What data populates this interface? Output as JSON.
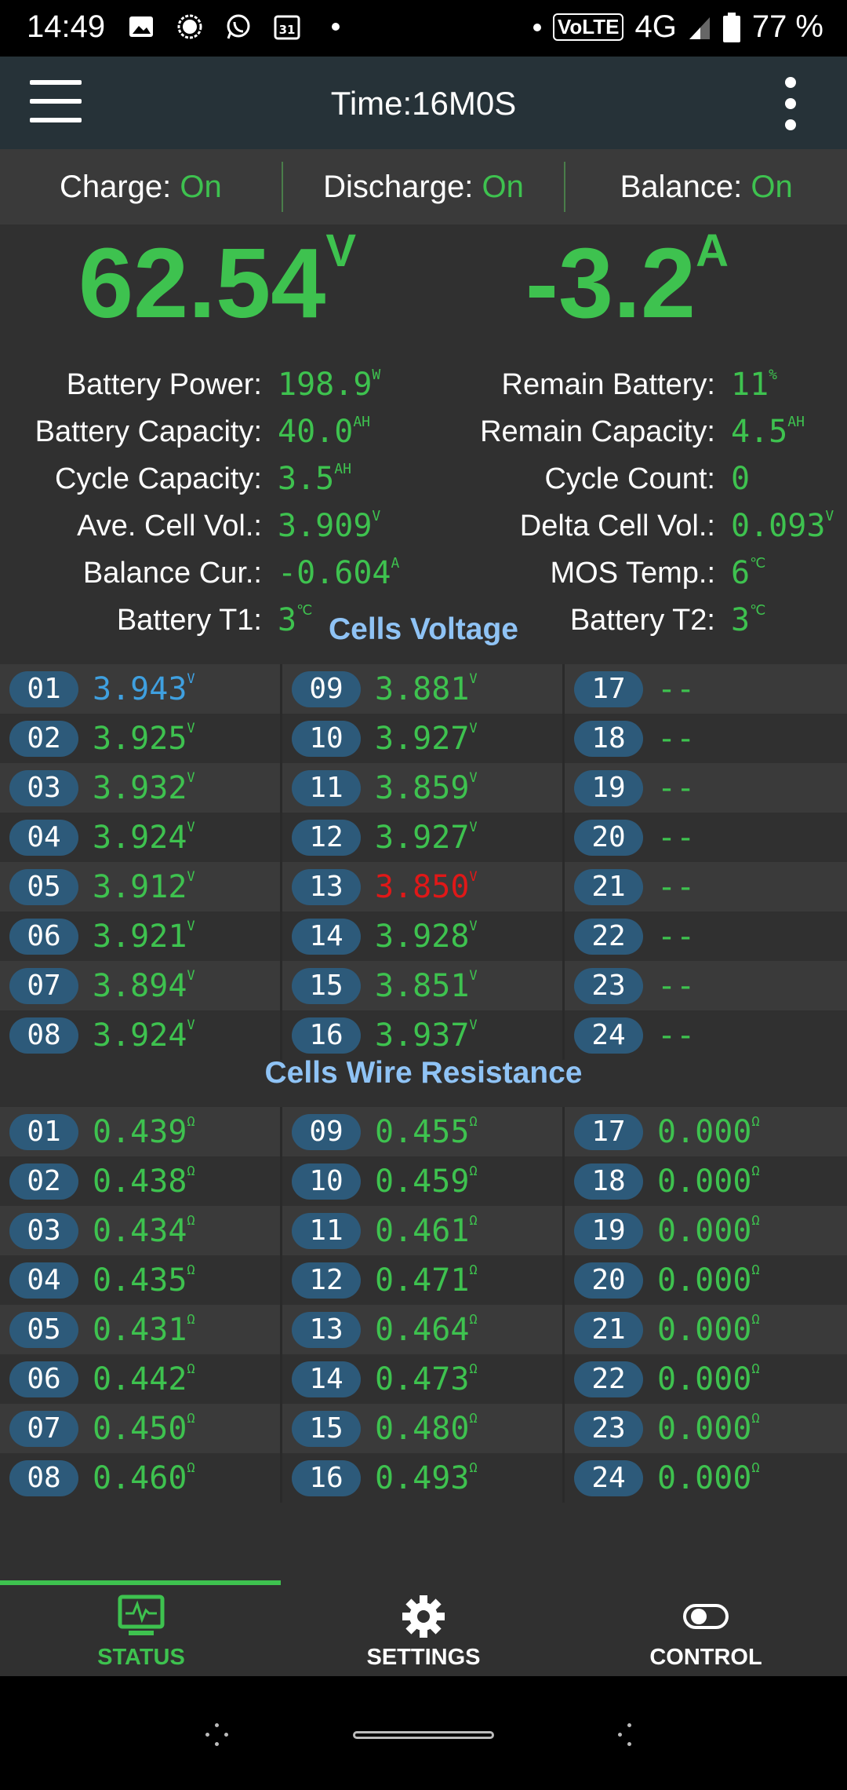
{
  "status_bar": {
    "time": "14:49",
    "volte": "VoLTE",
    "network": "4G",
    "battery": "77 %",
    "calendar_day": "31"
  },
  "app_bar": {
    "title": "Time:16M0S"
  },
  "toggles": [
    {
      "label": "Charge:",
      "value": "On"
    },
    {
      "label": "Discharge:",
      "value": "On"
    },
    {
      "label": "Balance:",
      "value": "On"
    }
  ],
  "main": {
    "voltage": "62.54",
    "voltage_unit": "V",
    "current": "-3.2",
    "current_unit": "A"
  },
  "stats_left": [
    {
      "label": "Battery Power:",
      "value": "198.9",
      "unit": "W"
    },
    {
      "label": "Battery Capacity:",
      "value": "40.0",
      "unit": "AH"
    },
    {
      "label": "Cycle Capacity:",
      "value": "3.5",
      "unit": "AH"
    },
    {
      "label": "Ave. Cell Vol.:",
      "value": "3.909",
      "unit": "V"
    },
    {
      "label": "Balance Cur.:",
      "value": "-0.604",
      "unit": "A"
    },
    {
      "label": "Battery T1:",
      "value": "3",
      "unit": "℃"
    }
  ],
  "stats_right": [
    {
      "label": "Remain Battery:",
      "value": "11",
      "unit": "%"
    },
    {
      "label": "Remain Capacity:",
      "value": "4.5",
      "unit": "AH"
    },
    {
      "label": "Cycle Count:",
      "value": "0",
      "unit": ""
    },
    {
      "label": "Delta Cell Vol.:",
      "value": "0.093",
      "unit": "V"
    },
    {
      "label": "MOS Temp.:",
      "value": "6",
      "unit": "℃"
    },
    {
      "label": "Battery T2:",
      "value": "3",
      "unit": "℃"
    }
  ],
  "cells_voltage": {
    "title": "Cells Voltage",
    "unit": "V",
    "cells": [
      {
        "id": "01",
        "value": "3.943",
        "color": "blue"
      },
      {
        "id": "02",
        "value": "3.925"
      },
      {
        "id": "03",
        "value": "3.932"
      },
      {
        "id": "04",
        "value": "3.924"
      },
      {
        "id": "05",
        "value": "3.912"
      },
      {
        "id": "06",
        "value": "3.921"
      },
      {
        "id": "07",
        "value": "3.894"
      },
      {
        "id": "08",
        "value": "3.924"
      },
      {
        "id": "09",
        "value": "3.881"
      },
      {
        "id": "10",
        "value": "3.927"
      },
      {
        "id": "11",
        "value": "3.859"
      },
      {
        "id": "12",
        "value": "3.927"
      },
      {
        "id": "13",
        "value": "3.850",
        "color": "red"
      },
      {
        "id": "14",
        "value": "3.928"
      },
      {
        "id": "15",
        "value": "3.851"
      },
      {
        "id": "16",
        "value": "3.937"
      },
      {
        "id": "17",
        "value": "--",
        "empty": true
      },
      {
        "id": "18",
        "value": "--",
        "empty": true
      },
      {
        "id": "19",
        "value": "--",
        "empty": true
      },
      {
        "id": "20",
        "value": "--",
        "empty": true
      },
      {
        "id": "21",
        "value": "--",
        "empty": true
      },
      {
        "id": "22",
        "value": "--",
        "empty": true
      },
      {
        "id": "23",
        "value": "--",
        "empty": true
      },
      {
        "id": "24",
        "value": "--",
        "empty": true
      }
    ]
  },
  "cells_resistance": {
    "title": "Cells Wire Resistance",
    "unit": "Ω",
    "cells": [
      {
        "id": "01",
        "value": "0.439"
      },
      {
        "id": "02",
        "value": "0.438"
      },
      {
        "id": "03",
        "value": "0.434"
      },
      {
        "id": "04",
        "value": "0.435"
      },
      {
        "id": "05",
        "value": "0.431"
      },
      {
        "id": "06",
        "value": "0.442"
      },
      {
        "id": "07",
        "value": "0.450"
      },
      {
        "id": "08",
        "value": "0.460"
      },
      {
        "id": "09",
        "value": "0.455"
      },
      {
        "id": "10",
        "value": "0.459"
      },
      {
        "id": "11",
        "value": "0.461"
      },
      {
        "id": "12",
        "value": "0.471"
      },
      {
        "id": "13",
        "value": "0.464"
      },
      {
        "id": "14",
        "value": "0.473"
      },
      {
        "id": "15",
        "value": "0.480"
      },
      {
        "id": "16",
        "value": "0.493"
      },
      {
        "id": "17",
        "value": "0.000"
      },
      {
        "id": "18",
        "value": "0.000"
      },
      {
        "id": "19",
        "value": "0.000"
      },
      {
        "id": "20",
        "value": "0.000"
      },
      {
        "id": "21",
        "value": "0.000"
      },
      {
        "id": "22",
        "value": "0.000"
      },
      {
        "id": "23",
        "value": "0.000"
      },
      {
        "id": "24",
        "value": "0.000"
      }
    ]
  },
  "bottom_nav": [
    {
      "label": "STATUS",
      "icon": "monitor-pulse-icon",
      "active": true
    },
    {
      "label": "SETTINGS",
      "icon": "gear-icon",
      "active": false
    },
    {
      "label": "CONTROL",
      "icon": "toggle-icon",
      "active": false
    }
  ],
  "colors": {
    "accent_green": "#3ec24f",
    "section_title": "#8fc3f5",
    "badge": "#2d5a7a",
    "appbar": "#263238",
    "low_cell": "#e01818",
    "high_cell": "#3fa0e0"
  }
}
